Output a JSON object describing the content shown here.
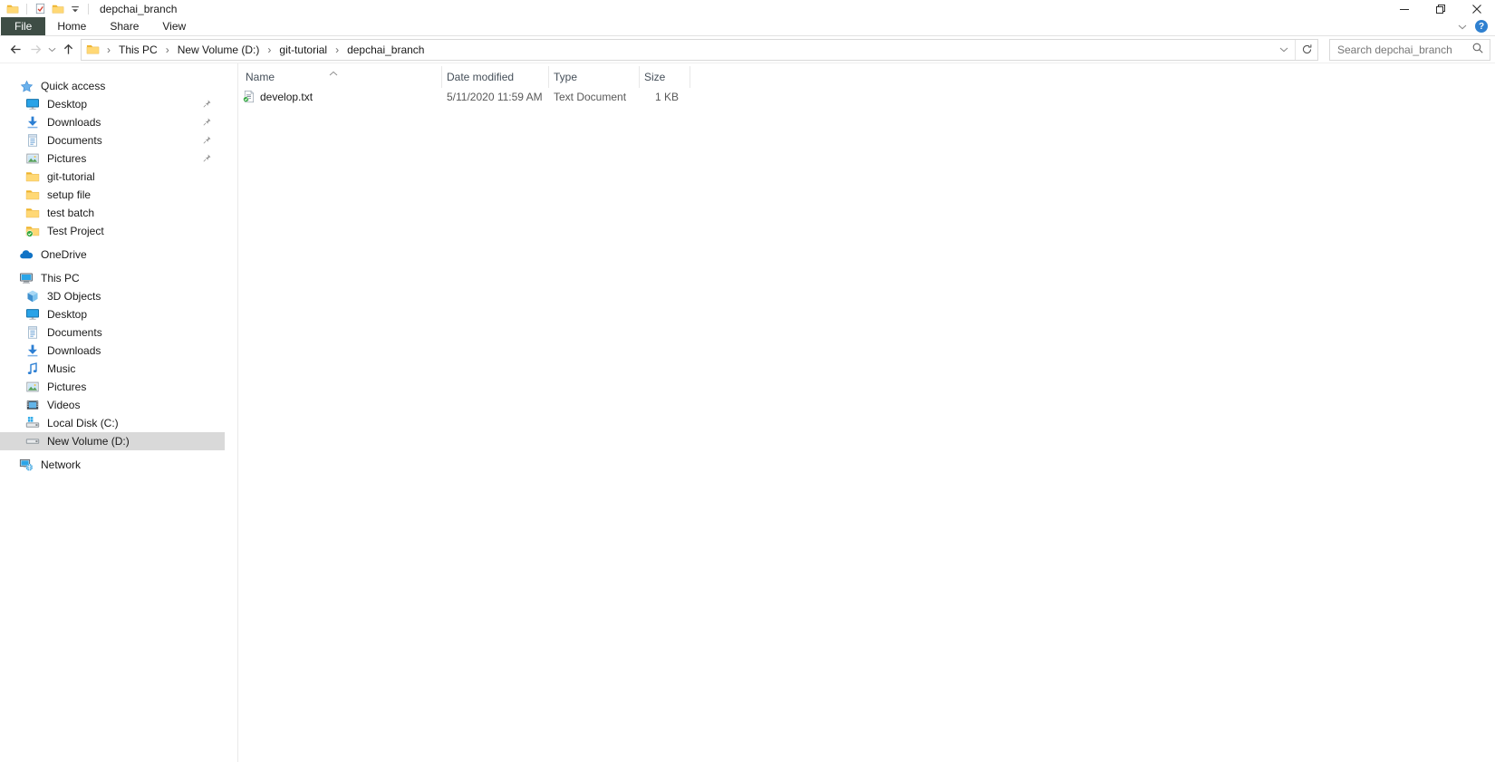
{
  "window": {
    "title": "depchai_branch"
  },
  "ribbon": {
    "tabs": [
      "File",
      "Home",
      "Share",
      "View"
    ],
    "active_tab": "File"
  },
  "address": {
    "crumbs": [
      "This PC",
      "New Volume (D:)",
      "git-tutorial",
      "depchai_branch"
    ]
  },
  "search": {
    "placeholder": "Search depchai_branch"
  },
  "sidebar": {
    "sections": [
      {
        "label": "Quick access",
        "icon": "star",
        "items": [
          {
            "label": "Desktop",
            "icon": "desktop",
            "pinned": true
          },
          {
            "label": "Downloads",
            "icon": "downloads",
            "pinned": true
          },
          {
            "label": "Documents",
            "icon": "documents",
            "pinned": true
          },
          {
            "label": "Pictures",
            "icon": "pictures",
            "pinned": true
          },
          {
            "label": "git-tutorial",
            "icon": "folder"
          },
          {
            "label": "setup file",
            "icon": "folder"
          },
          {
            "label": "test batch",
            "icon": "folder"
          },
          {
            "label": "Test Project",
            "icon": "folder-synced"
          }
        ]
      },
      {
        "label": "OneDrive",
        "icon": "onedrive-cloud",
        "items": []
      },
      {
        "label": "This PC",
        "icon": "computer",
        "items": [
          {
            "label": "3D Objects",
            "icon": "3d-cube"
          },
          {
            "label": "Desktop",
            "icon": "desktop"
          },
          {
            "label": "Documents",
            "icon": "documents"
          },
          {
            "label": "Downloads",
            "icon": "downloads"
          },
          {
            "label": "Music",
            "icon": "music"
          },
          {
            "label": "Pictures",
            "icon": "pictures"
          },
          {
            "label": "Videos",
            "icon": "videos"
          },
          {
            "label": "Local Disk (C:)",
            "icon": "disk-windows"
          },
          {
            "label": "New Volume (D:)",
            "icon": "disk",
            "selected": true
          }
        ]
      },
      {
        "label": "Network",
        "icon": "network",
        "items": []
      }
    ]
  },
  "file_list": {
    "columns": [
      "Name",
      "Date modified",
      "Type",
      "Size"
    ],
    "sort": {
      "column": "Name",
      "direction": "ascending"
    },
    "rows": [
      {
        "name": "develop.txt",
        "icon": "text-file-synced",
        "date_modified": "5/11/2020 11:59 AM",
        "type": "Text Document",
        "size": "1 KB"
      }
    ]
  },
  "colors": {
    "file_tab_bg": "#3e4d45",
    "sidebar_selection_bg": "#d9d9d9",
    "folder_yellow": "#f9c74f",
    "onedrive_blue": "#1173c5",
    "help_badge_blue": "#2f80d0",
    "sync_check_green": "#2fa63c"
  }
}
